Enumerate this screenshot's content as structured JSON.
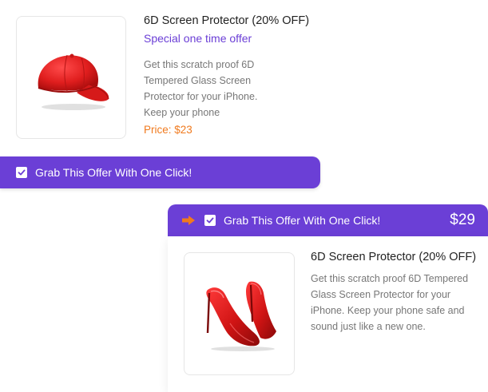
{
  "offer1": {
    "image": "red-cap-image",
    "title": "6D Screen Protector (20% OFF)",
    "subtitle": "Special one time offer",
    "description": "Get this scratch proof 6D Tempered Glass Screen Protector for your iPhone. Keep your phone",
    "price": "Price: $23",
    "cta_label": "Grab This Offer With One Click!",
    "checked": true
  },
  "offer2": {
    "image": "red-high-heels-image",
    "cta_label": "Grab This Offer With One Click!",
    "cta_price": "$29",
    "checked": true,
    "title": "6D Screen Protector (20% OFF)",
    "description": "Get this scratch proof 6D Tempered Glass Screen Protector for your iPhone. Keep your phone safe and sound just like a new one."
  },
  "colors": {
    "accent_purple": "#6b3fd6",
    "price_orange": "#f07a1e",
    "arrow_orange": "#f07a1e"
  }
}
